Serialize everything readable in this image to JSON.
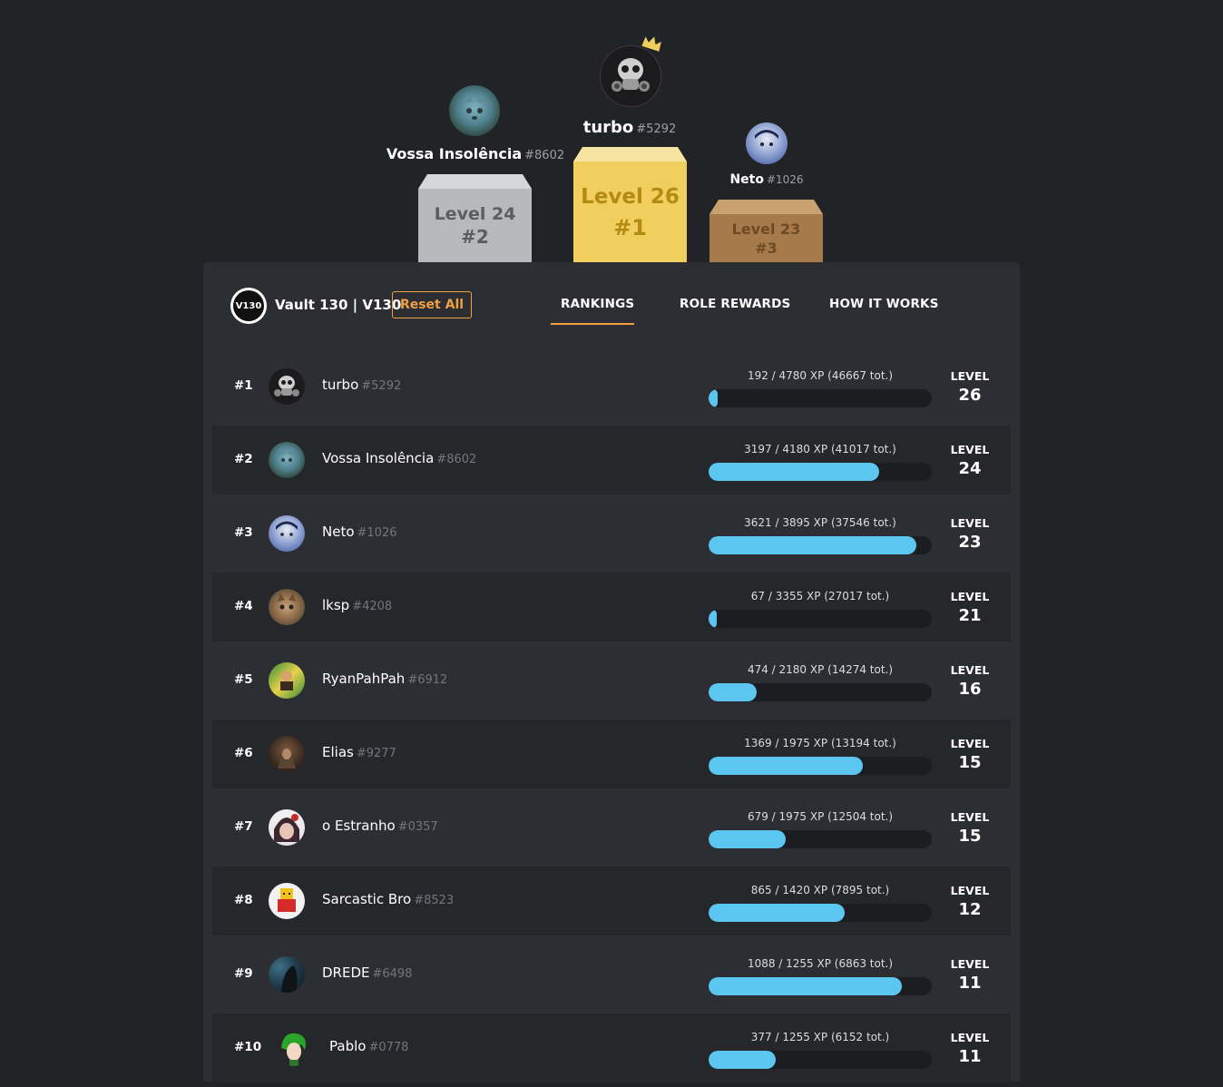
{
  "podium": {
    "first": {
      "name": "turbo",
      "disc": "#5292",
      "level": "Level 26",
      "rank": "#1",
      "icon": "crown-icon"
    },
    "second": {
      "name": "Vossa Insolência",
      "disc": "#8602",
      "level": "Level 24",
      "rank": "#2"
    },
    "third": {
      "name": "Neto",
      "disc": "#1026",
      "level": "Level 23",
      "rank": "#3"
    },
    "colors": {
      "gold": "#f1cf5f",
      "silver": "#b8b9bb",
      "bronze": "#a67a4a"
    }
  },
  "header": {
    "server_icon_text": "V130",
    "server_name": "Vault 130 | V130",
    "reset_label": "Reset All",
    "tabs": [
      "RANKINGS",
      "ROLE REWARDS",
      "HOW IT WORKS"
    ],
    "active_tab": "RANKINGS",
    "accent": "#f0a040"
  },
  "level_label": "LEVEL",
  "rows": [
    {
      "rank": "#1",
      "name": "turbo",
      "disc": "#5292",
      "xp": "192 / 4780 XP (46667 tot.)",
      "progress": 0.04,
      "level": "26"
    },
    {
      "rank": "#2",
      "name": "Vossa Insolência",
      "disc": "#8602",
      "xp": "3197 / 4180 XP (41017 tot.)",
      "progress": 0.765,
      "level": "24"
    },
    {
      "rank": "#3",
      "name": "Neto",
      "disc": "#1026",
      "xp": "3621 / 3895 XP (37546 tot.)",
      "progress": 0.93,
      "level": "23"
    },
    {
      "rank": "#4",
      "name": "lksp",
      "disc": "#4208",
      "xp": "67 / 3355 XP (27017 tot.)",
      "progress": 0.02,
      "level": "21"
    },
    {
      "rank": "#5",
      "name": "RyanPahPah",
      "disc": "#6912",
      "xp": "474 / 2180 XP (14274 tot.)",
      "progress": 0.217,
      "level": "16"
    },
    {
      "rank": "#6",
      "name": "Elias",
      "disc": "#9277",
      "xp": "1369 / 1975 XP (13194 tot.)",
      "progress": 0.693,
      "level": "15"
    },
    {
      "rank": "#7",
      "name": "o Estranho",
      "disc": "#0357",
      "xp": "679 / 1975 XP (12504 tot.)",
      "progress": 0.344,
      "level": "15"
    },
    {
      "rank": "#8",
      "name": "Sarcastic Bro",
      "disc": "#8523",
      "xp": "865 / 1420 XP (7895 tot.)",
      "progress": 0.609,
      "level": "12"
    },
    {
      "rank": "#9",
      "name": "DREDE",
      "disc": "#6498",
      "xp": "1088 / 1255 XP (6863 tot.)",
      "progress": 0.867,
      "level": "11"
    },
    {
      "rank": "#10",
      "name": "Pablo",
      "disc": "#0778",
      "xp": "377 / 1255 XP (6152 tot.)",
      "progress": 0.3,
      "level": "11"
    }
  ]
}
